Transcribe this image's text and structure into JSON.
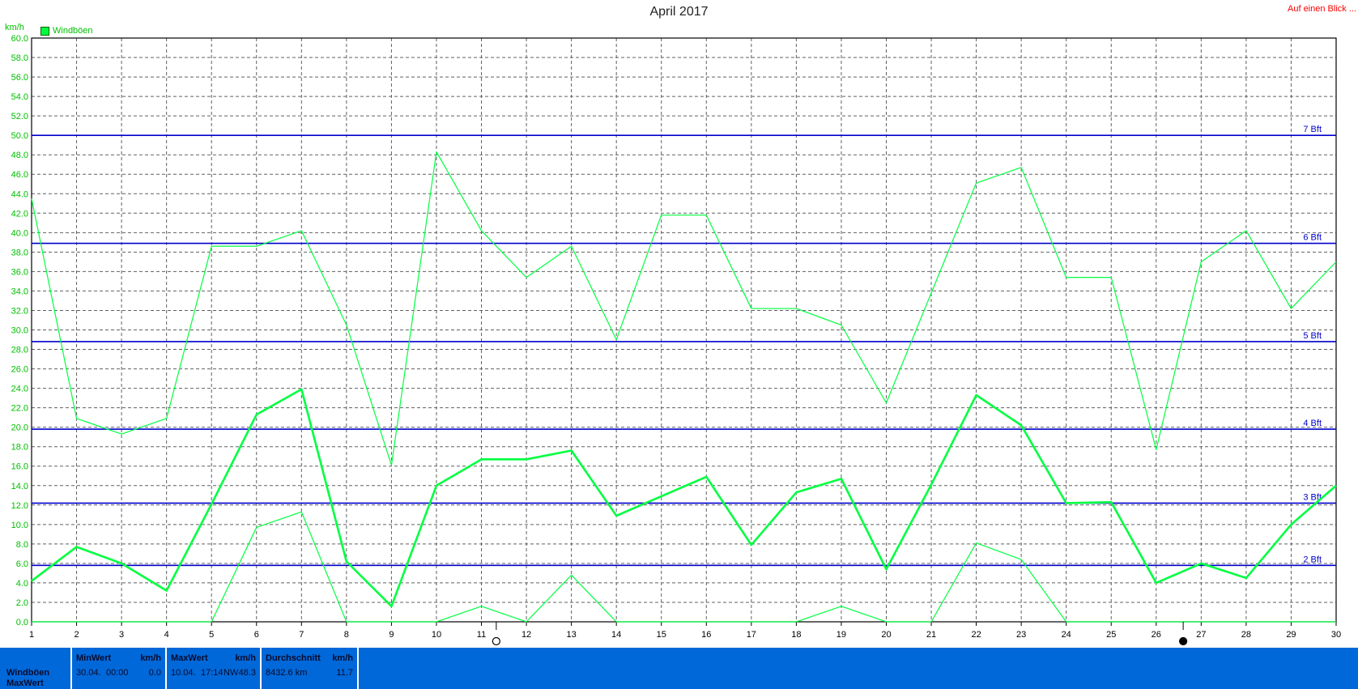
{
  "title": "April 2017",
  "link_text": "Auf einen Blick ...",
  "unit": "km/h",
  "legend_label": "Windböen",
  "colors": {
    "series": "#00ff40",
    "bft": "#0000cc",
    "grid": "#606060",
    "footer": "#0068d9",
    "link": "#ff0000"
  },
  "chart_data": {
    "type": "line",
    "title": "April 2017",
    "ylabel": "km/h",
    "ylim": [
      0,
      60
    ],
    "y_ticks": [
      "0.0",
      "2.0",
      "4.0",
      "6.0",
      "8.0",
      "10.0",
      "12.0",
      "14.0",
      "16.0",
      "18.0",
      "20.0",
      "22.0",
      "24.0",
      "26.0",
      "28.0",
      "30.0",
      "32.0",
      "34.0",
      "36.0",
      "38.0",
      "40.0",
      "42.0",
      "44.0",
      "46.0",
      "48.0",
      "50.0",
      "52.0",
      "54.0",
      "56.0",
      "58.0",
      "60.0"
    ],
    "x": [
      1,
      2,
      3,
      4,
      5,
      6,
      7,
      8,
      9,
      10,
      11,
      12,
      13,
      14,
      15,
      16,
      17,
      18,
      19,
      20,
      21,
      22,
      23,
      24,
      25,
      26,
      27,
      28,
      29,
      30
    ],
    "grid": true,
    "legend_position": "top-left",
    "series": [
      {
        "name": "Windböen",
        "role": "max",
        "values": [
          43.5,
          20.9,
          19.3,
          20.9,
          38.6,
          38.6,
          40.2,
          30.5,
          16.1,
          48.3,
          40.2,
          35.4,
          38.6,
          29.0,
          41.8,
          41.8,
          32.2,
          32.2,
          30.5,
          22.5,
          33.8,
          45.1,
          46.7,
          35.4,
          35.4,
          17.7,
          37.0,
          40.2,
          32.2,
          37.0
        ]
      },
      {
        "name": "Windböen",
        "role": "avg",
        "values": [
          4.2,
          7.7,
          6.0,
          3.2,
          12.1,
          21.3,
          23.9,
          6.2,
          1.6,
          14.0,
          16.7,
          16.7,
          17.6,
          10.9,
          12.9,
          14.9,
          7.9,
          13.3,
          14.7,
          5.4,
          14.1,
          23.3,
          20.2,
          12.2,
          12.3,
          4.0,
          6.0,
          4.5,
          10.0,
          14.0
        ]
      },
      {
        "name": "Windböen",
        "role": "min",
        "values": [
          0.0,
          0.0,
          0.0,
          0.0,
          0.0,
          9.7,
          11.3,
          0.0,
          0.0,
          0.0,
          1.6,
          0.0,
          4.8,
          0.0,
          0.0,
          0.0,
          0.0,
          0.0,
          1.6,
          0.0,
          0.0,
          8.1,
          6.4,
          0.0,
          0.0,
          0.0,
          0.0,
          0.0,
          0.0,
          0.0
        ]
      }
    ],
    "bft_lines": [
      {
        "label": "2 Bft",
        "value": 5.8
      },
      {
        "label": "3 Bft",
        "value": 12.2
      },
      {
        "label": "4 Bft",
        "value": 19.8
      },
      {
        "label": "5 Bft",
        "value": 28.8
      },
      {
        "label": "6 Bft",
        "value": 38.9
      },
      {
        "label": "7 Bft",
        "value": 50.0
      }
    ],
    "moon_markers": [
      {
        "phase": "full-moon",
        "x": 11.33
      },
      {
        "phase": "new-moon",
        "x": 26.6
      }
    ]
  },
  "footer": {
    "row_label_1": "Windböen",
    "row_label_2": "MaxWert",
    "min": {
      "label": "MinWert",
      "unit": "km/h",
      "date": "30.04.",
      "time": "00:00",
      "value": "0.0"
    },
    "max": {
      "label": "MaxWert",
      "unit": "km/h",
      "date": "10.04.",
      "time": "17:14",
      "dir": "NW",
      "value": "48.3"
    },
    "avg": {
      "label": "Durchschnitt",
      "unit": "km/h",
      "distance": "8432.6 km",
      "value": "11.7"
    }
  }
}
